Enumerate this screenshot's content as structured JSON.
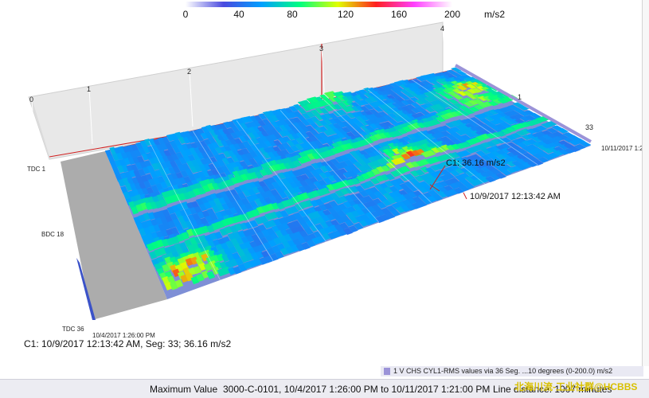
{
  "color_scale": {
    "ticks": [
      "0",
      "40",
      "80",
      "120",
      "160",
      "200"
    ],
    "unit": "m/s2",
    "colors": [
      "#ffffff",
      "#4a4adf",
      "#00a0ff",
      "#00ff80",
      "#e0ff00",
      "#ff2020",
      "#ff40ff",
      "#ffffff"
    ]
  },
  "chart_data": {
    "type": "heatmap",
    "description_type": "3d-waterfall",
    "z_range": [
      0,
      200
    ],
    "z_unit": "m/s2",
    "y_axis_labels": [
      "TDC 1",
      "BDC 18",
      "TDC 36"
    ],
    "x_start_label": "10/4/2017 1:26:00 PM",
    "x_end_label": "10/11/2017 1:2",
    "back_wall_ticks": [
      "0",
      "1",
      "2",
      "3",
      "4"
    ],
    "side_ticks": [
      "1",
      "33"
    ],
    "cursor": {
      "label": "C1: 36.16 m/s2",
      "time_label": "10/9/2017 12:13:42 AM",
      "info": "C1: 10/9/2017 12:13:42 AM, Seg: 33; 36.16 m/s2"
    },
    "bands": [
      {
        "segment_fraction": 0.42,
        "level": 95,
        "name": "dark band"
      },
      {
        "segment_fraction": 0.7,
        "level": 85,
        "name": "dark band"
      }
    ],
    "hotspots": [
      {
        "time_fraction": 0.08,
        "segment_fraction": 0.9,
        "peak": 120
      },
      {
        "time_fraction": 0.66,
        "segment_fraction": 0.65,
        "peak": 110
      },
      {
        "time_fraction": 0.93,
        "segment_fraction": 0.28,
        "peak": 125
      },
      {
        "time_fraction": 0.62,
        "segment_fraction": 0.02,
        "peak": 100
      },
      {
        "time_fraction": 0.02,
        "segment_fraction": 0.98,
        "peak": 90
      }
    ]
  },
  "legend": {
    "text": "1 V CHS CYL1-RMS values via 36 Seg. ...10 degrees (0-200.0) m/s2",
    "color": "#9b93d8"
  },
  "status_bar": {
    "label": "Maximum Value",
    "value": "3000-C-0101, 10/4/2017 1:26:00 PM to 10/11/2017 1:21:00 PM",
    "line_distance": "Line distance: 1007 minutes"
  },
  "watermark": "北海川流-工业社群@HCBBS"
}
